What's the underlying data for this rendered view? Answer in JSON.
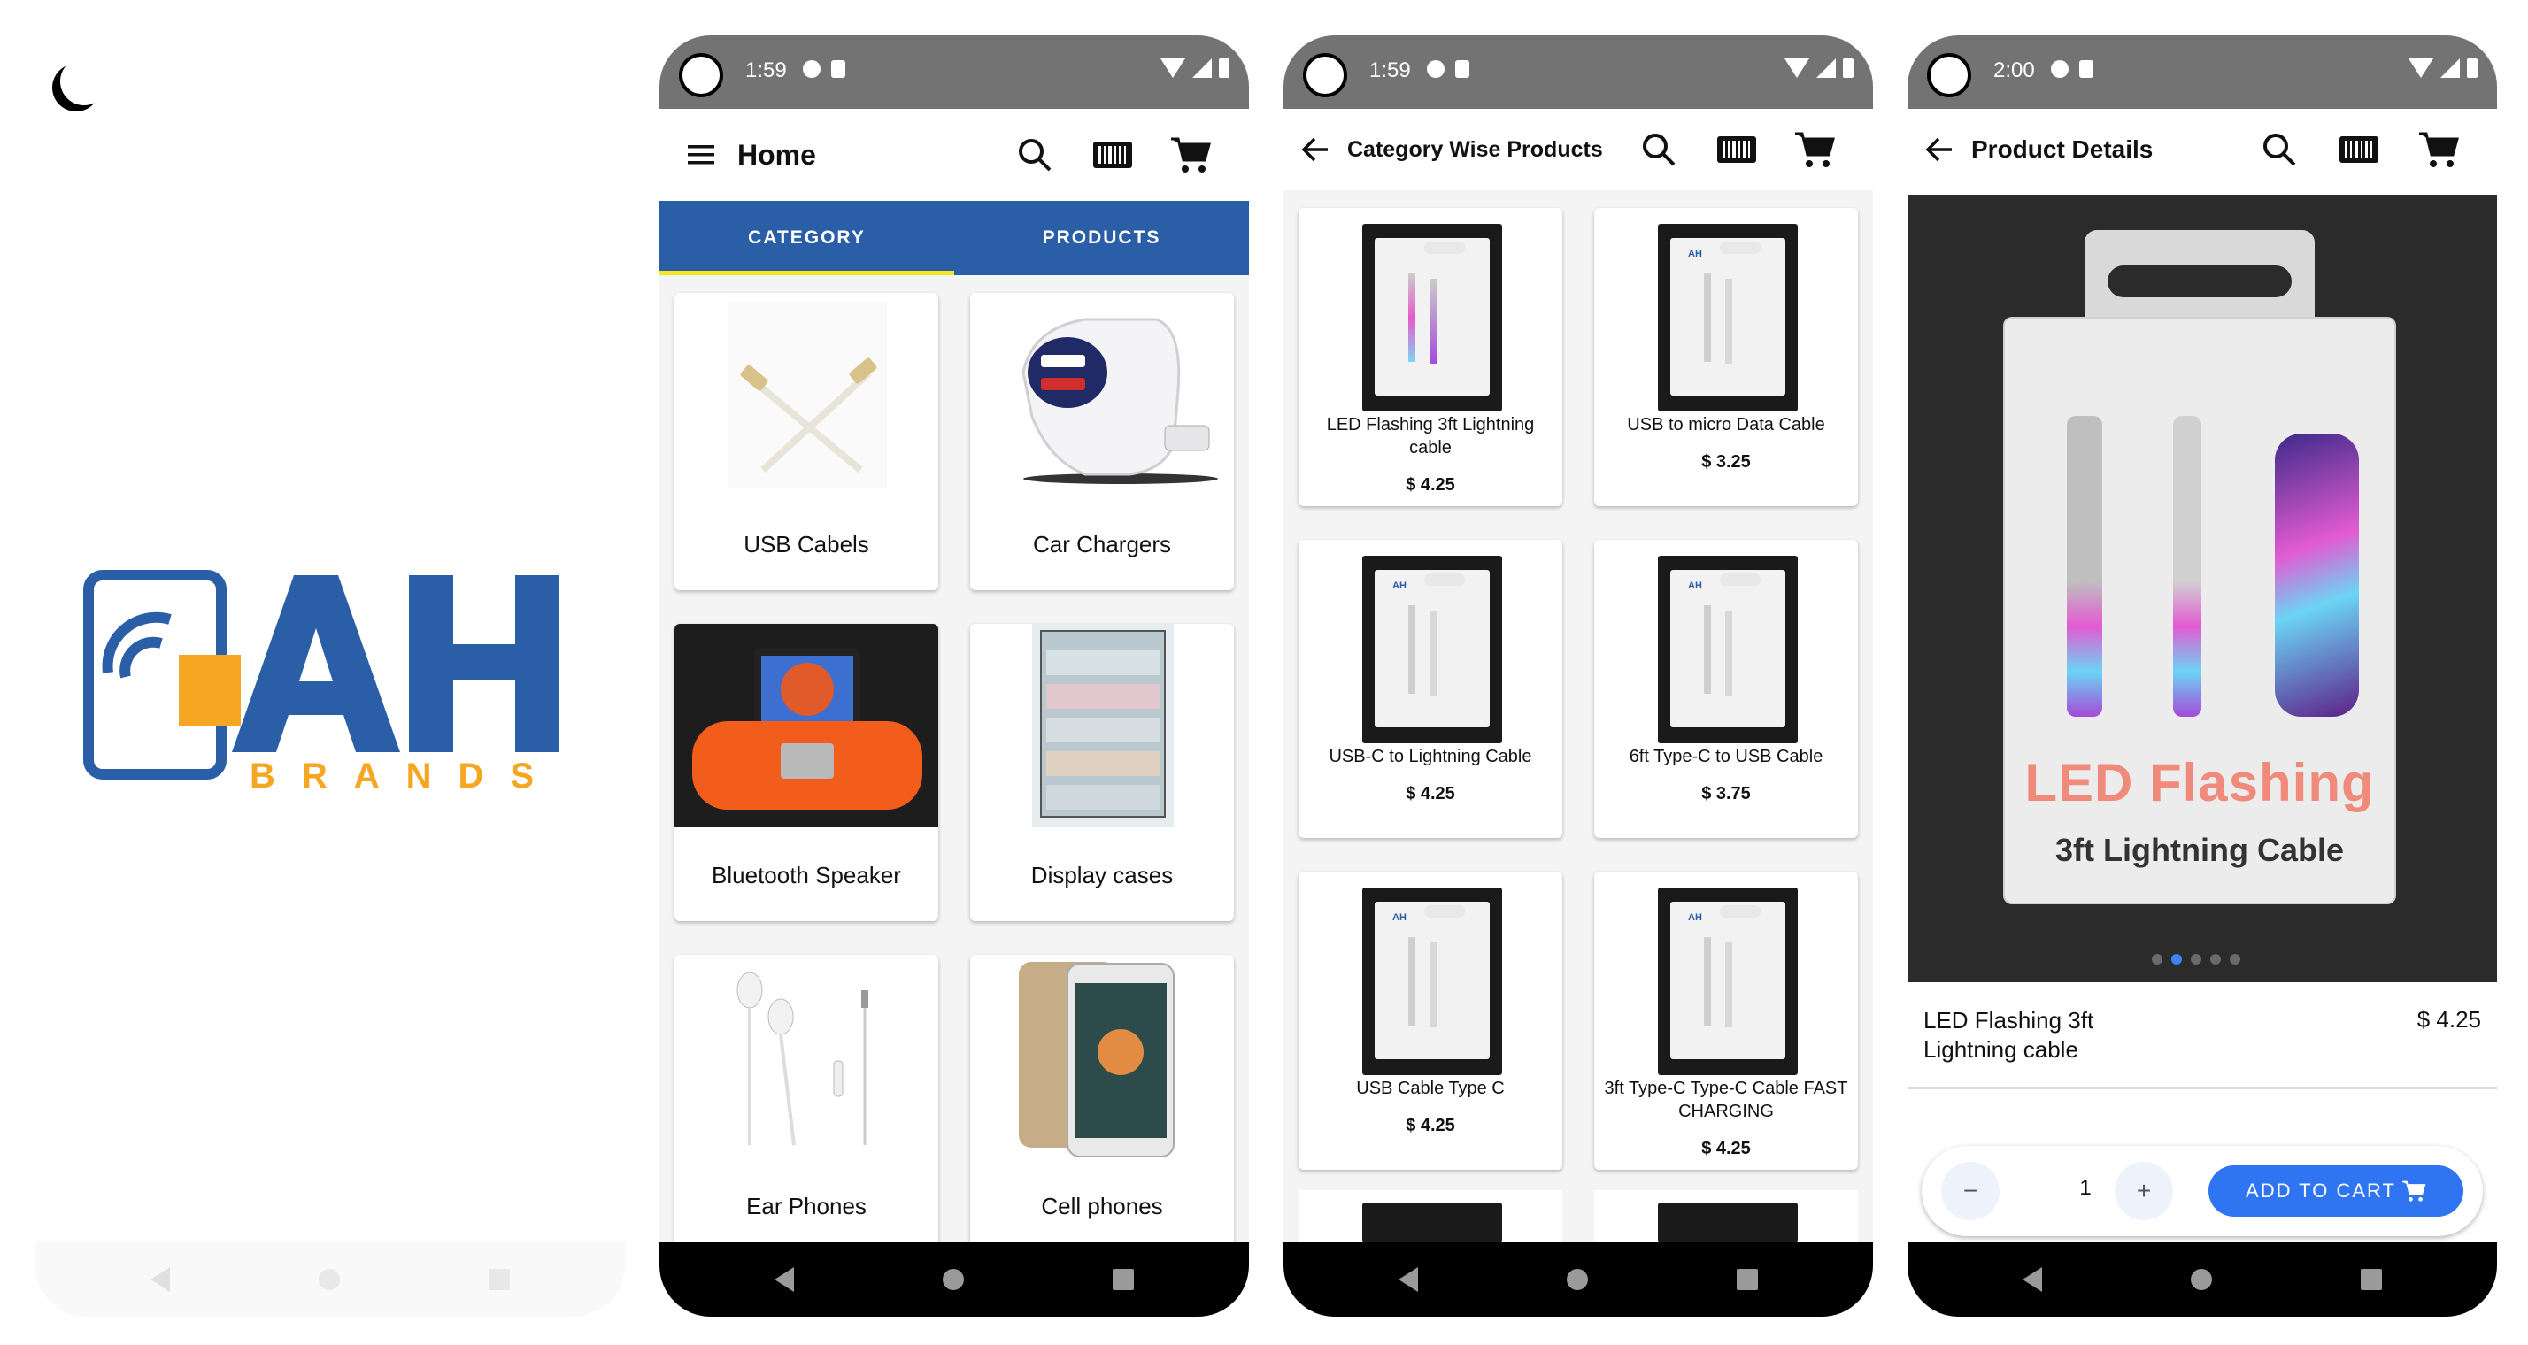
{
  "colors": {
    "tab_blue": "#2a5ea6",
    "tab_indicator": "#f6e71e",
    "accent_blue": "#2f74f0",
    "logo_blue": "#2a5ea6",
    "logo_orange": "#f5a623"
  },
  "splash": {
    "logo_text": "AH",
    "logo_subtext": "BRANDS"
  },
  "screens": {
    "home": {
      "time": "1:59",
      "title": "Home",
      "tabs": [
        "CATEGORY",
        "PRODUCTS"
      ],
      "active_tab": "CATEGORY",
      "categories": [
        "USB Cabels",
        "Car Chargers",
        "Bluetooth Speaker",
        "Display cases",
        "Ear Phones",
        "Cell phones"
      ]
    },
    "category": {
      "time": "1:59",
      "title": "Category Wise Products",
      "products": [
        {
          "name": "LED Flashing 3ft Lightning cable",
          "price": "$ 4.25"
        },
        {
          "name": "USB to micro Data Cable",
          "price": "$ 3.25"
        },
        {
          "name": "USB-C to Lightning Cable",
          "price": "$ 4.25"
        },
        {
          "name": "6ft Type-C to USB Cable",
          "price": "$ 3.75"
        },
        {
          "name": "USB Cable Type C",
          "price": "$ 4.25"
        },
        {
          "name": "3ft Type-C Type-C Cable FAST CHARGING",
          "price": "$ 4.25"
        }
      ]
    },
    "detail": {
      "time": "2:00",
      "title": "Product Details",
      "image_text_1": "LED Flashing",
      "image_text_2": "3ft Lightning Cable",
      "product_name": "LED Flashing 3ft Lightning cable",
      "price": "$ 4.25",
      "quantity": "1",
      "minus": "−",
      "plus": "+",
      "add_to_cart": "ADD TO CART",
      "carousel_active": 1,
      "carousel_count": 5
    }
  },
  "icons": [
    "moon-icon",
    "menu-icon",
    "back-arrow-icon",
    "search-icon",
    "barcode-icon",
    "cart-icon"
  ]
}
